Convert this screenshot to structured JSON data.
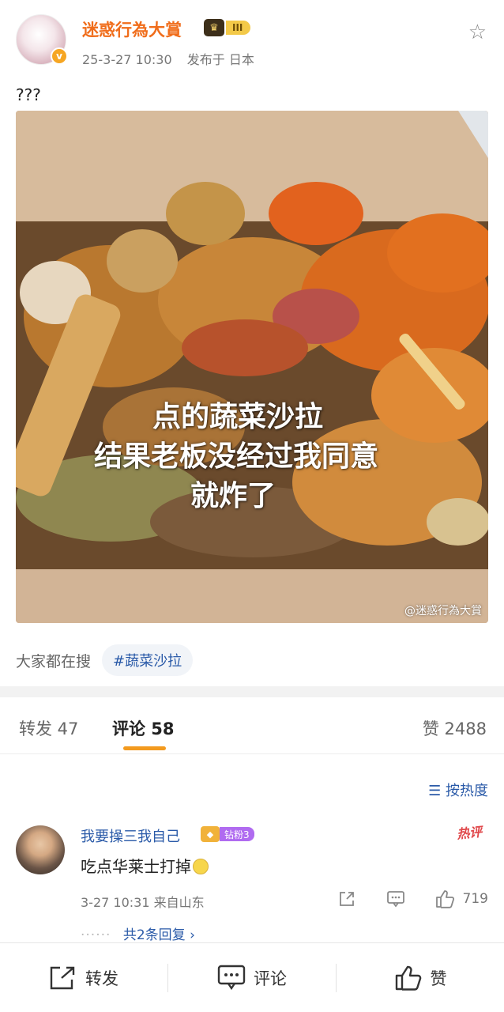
{
  "post": {
    "author": "迷惑行為大賞",
    "rank_badge": "III",
    "date": "25-3-27 10:30",
    "location": "发布于 日本",
    "text": "???",
    "image": {
      "overlay_lines": [
        "点的蔬菜沙拉",
        "结果老板没经过我同意",
        "就炸了"
      ],
      "watermark": "@迷惑行為大賞"
    },
    "trending_label": "大家都在搜",
    "trending_tag": "#蔬菜沙拉"
  },
  "tabs": {
    "repost": "转发 47",
    "comments": "评论 58",
    "likes": "赞 2488"
  },
  "sort_label": "按热度",
  "comment": {
    "user": "我要操三我自己",
    "fan_badge": "钻粉3",
    "hot_label": "热评",
    "text": "吃点华莱士打掉",
    "time": "3-27 10:31",
    "from": "来自山东",
    "likes": "719",
    "replies": "共2条回复"
  },
  "bottom_bar": {
    "repost": "转发",
    "comment": "评论",
    "like": "赞"
  },
  "colors": {
    "author_orange": "#f06d1b",
    "link_blue": "#2a5aa8",
    "tab_underline": "#f39a1e",
    "hot_red": "#e0474a"
  }
}
